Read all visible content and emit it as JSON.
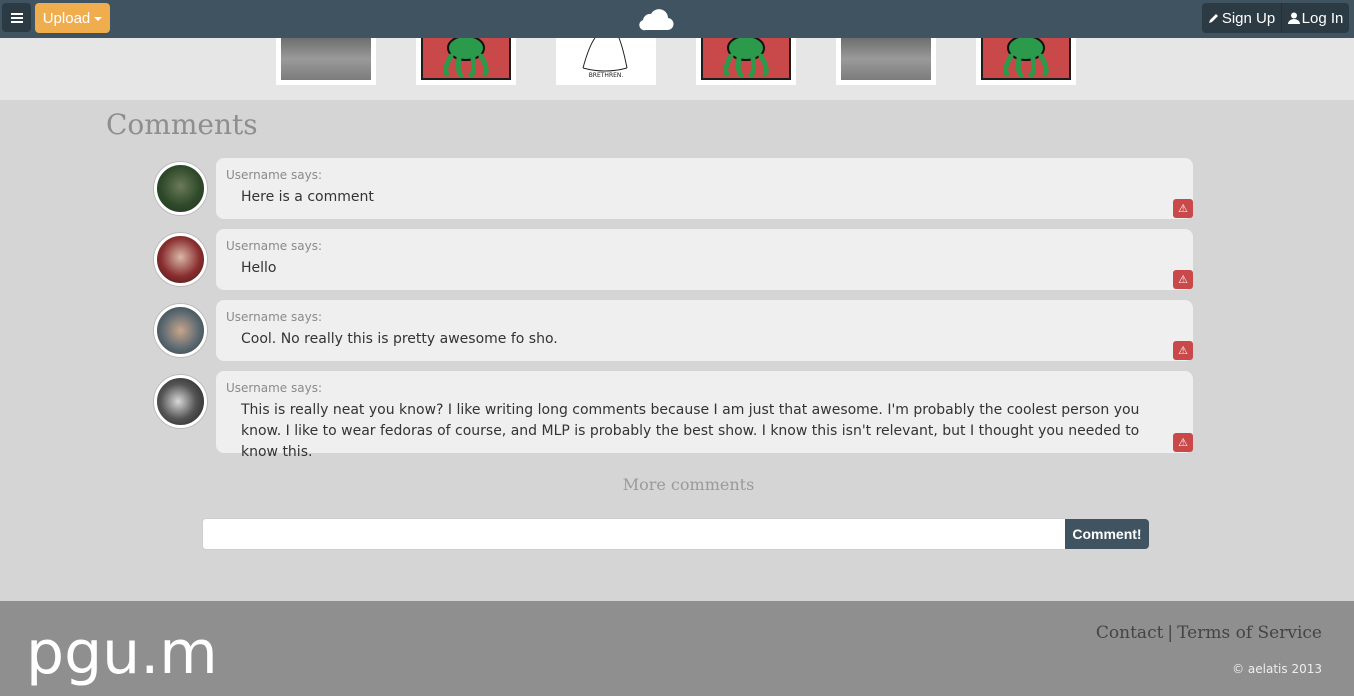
{
  "navbar": {
    "upload_label": "Upload",
    "signup_label": "Sign Up",
    "login_label": "Log In",
    "icons": {
      "menu": "hamburger-icon",
      "logo": "cloud-icon",
      "signup": "pencil-icon",
      "login": "user-icon"
    }
  },
  "thumbnails": [
    {
      "kind": "photo",
      "color": "#8a8a8a"
    },
    {
      "kind": "frog",
      "color": "#c9494a"
    },
    {
      "kind": "sketch",
      "caption": "BRETHREN."
    },
    {
      "kind": "frog",
      "color": "#c9494a"
    },
    {
      "kind": "photo",
      "color": "#8a8a8a"
    },
    {
      "kind": "frog",
      "color": "#c9494a"
    }
  ],
  "comments_section": {
    "title": "Comments",
    "items": [
      {
        "author": "Username says:",
        "text": "Here is a comment"
      },
      {
        "author": "Username says:",
        "text": "Hello"
      },
      {
        "author": "Username says:",
        "text": "Cool. No really this is pretty awesome fo sho."
      },
      {
        "author": "Username says:",
        "text": "This is really neat you know? I like writing long comments because I am just that awesome. I'm probably the coolest person you know. I like to wear fedoras of course, and MLP is probably the best show. I know this isn't relevant, but I thought you needed to know this."
      }
    ],
    "more_label": "More comments",
    "input_value": "",
    "submit_label": "Comment!"
  },
  "footer": {
    "logo_text": "pgu.me",
    "contact_label": "Contact",
    "separator": "|",
    "terms_label": "Terms of Service",
    "copyright": "© aelatis 2013"
  },
  "colors": {
    "navbar": "#3f5360",
    "upload": "#f0ad4e",
    "flag": "#c9494a",
    "footer": "#8f8f8f",
    "page": "#d5d5d5"
  }
}
